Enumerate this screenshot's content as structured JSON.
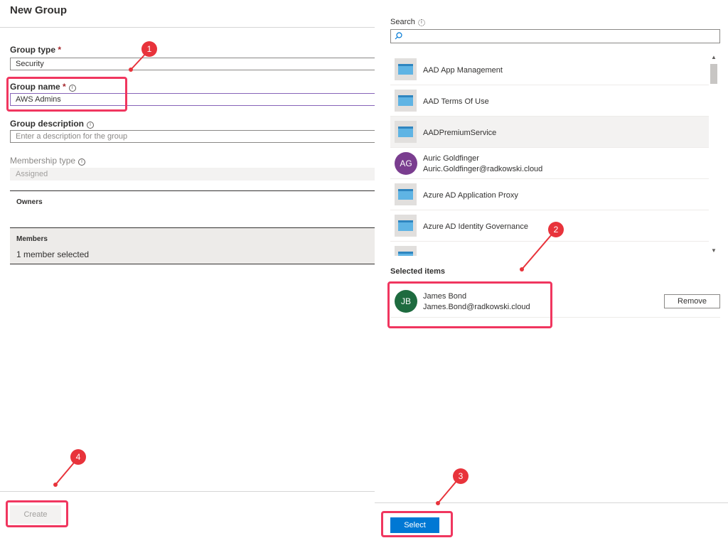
{
  "left": {
    "title": "New Group",
    "group_type": {
      "label": "Group type",
      "required_mark": "*",
      "value": "Security"
    },
    "group_name": {
      "label": "Group name",
      "required_mark": "*",
      "info": "i",
      "value": "AWS Admins"
    },
    "group_description": {
      "label": "Group description",
      "info": "i",
      "placeholder": "Enter a description for the group"
    },
    "membership_type": {
      "label": "Membership type",
      "info": "i",
      "value": "Assigned"
    },
    "owners": {
      "title": "Owners"
    },
    "members": {
      "title": "Members",
      "count_text": "1 member selected"
    },
    "create_label": "Create"
  },
  "right": {
    "search": {
      "label": "Search",
      "info": "i",
      "value": ""
    },
    "items": [
      {
        "kind": "app",
        "name": "AAD App Management",
        "icon": "app-icon"
      },
      {
        "kind": "app",
        "name": "AAD Terms Of Use",
        "icon": "app-icon"
      },
      {
        "kind": "app",
        "name": "AADPremiumService",
        "icon": "app-icon",
        "highlighted": true
      },
      {
        "kind": "user",
        "name": "Auric Goldfinger",
        "initials": "AG",
        "email": "Auric.Goldfinger@radkowski.cloud",
        "avatar_color": "#7a3d8f"
      },
      {
        "kind": "app",
        "name": "Azure AD Application Proxy",
        "icon": "app-icon"
      },
      {
        "kind": "app",
        "name": "Azure AD Identity Governance",
        "icon": "app-icon"
      }
    ],
    "selected_title": "Selected items",
    "selected": [
      {
        "name": "James Bond",
        "initials": "JB",
        "email": "James.Bond@radkowski.cloud",
        "avatar_color": "#1e6b3f",
        "remove_label": "Remove"
      }
    ],
    "select_label": "Select"
  },
  "annotations": [
    "1",
    "2",
    "3",
    "4"
  ],
  "colors": {
    "accent": "#0078d4",
    "annotation": "#f0365f",
    "badge": "#e8333b",
    "focus_border": "#8764b8"
  }
}
